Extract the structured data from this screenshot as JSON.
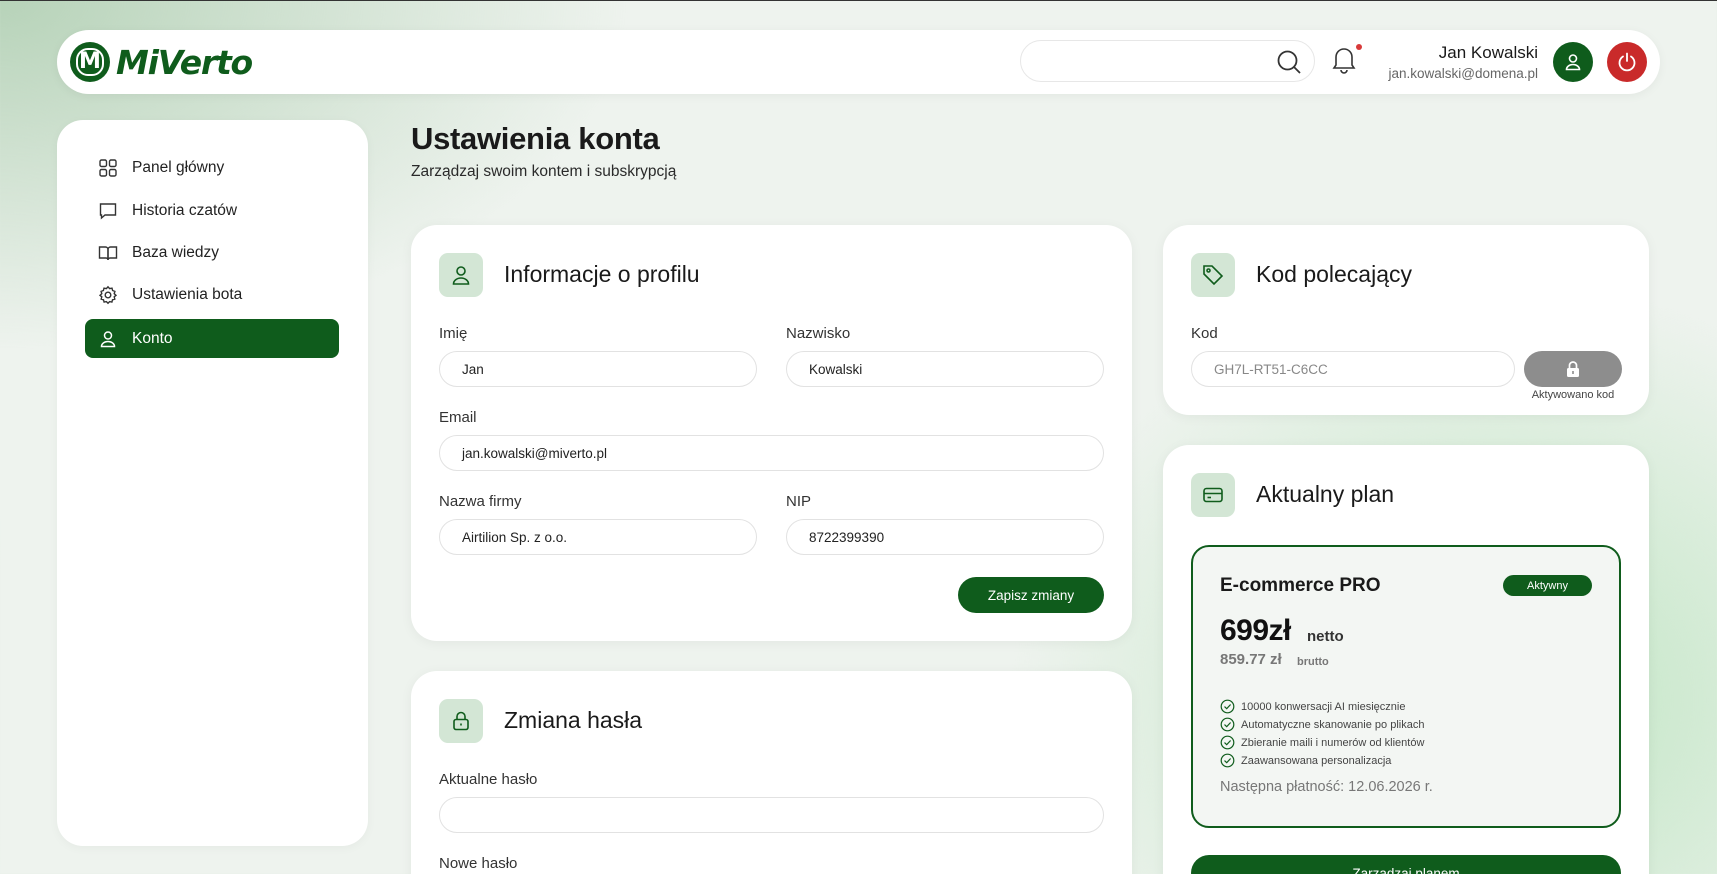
{
  "app": {
    "logo_text": "MiVerto",
    "logo_letter": "M"
  },
  "header": {
    "search_placeholder": "",
    "user_name": "Jan Kowalski",
    "user_email": "jan.kowalski@domena.pl"
  },
  "sidebar": {
    "items": [
      {
        "label": "Panel główny",
        "icon": "grid-icon"
      },
      {
        "label": "Historia czatów",
        "icon": "chat-icon"
      },
      {
        "label": "Baza wiedzy",
        "icon": "book-icon"
      },
      {
        "label": "Ustawienia bota",
        "icon": "gear-icon"
      },
      {
        "label": "Konto",
        "icon": "user-icon",
        "active": true
      }
    ]
  },
  "page": {
    "title": "Ustawienia konta",
    "subtitle": "Zarządzaj swoim kontem i subskrypcją"
  },
  "profile": {
    "title": "Informacje o profilu",
    "first_name_label": "Imię",
    "first_name_value": "Jan",
    "last_name_label": "Nazwisko",
    "last_name_value": "Kowalski",
    "email_label": "Email",
    "email_value": "jan.kowalski@miverto.pl",
    "company_label": "Nazwa firmy",
    "company_value": "Airtilion Sp. z o.o.",
    "nip_label": "NIP",
    "nip_value": "8722399390",
    "save_label": "Zapisz zmiany"
  },
  "password": {
    "title": "Zmiana hasła",
    "current_label": "Aktualne hasło",
    "current_value": "",
    "new_label": "Nowe hasło"
  },
  "referral": {
    "title": "Kod polecający",
    "code_label": "Kod",
    "code_value": "GH7L-RT51-C6CC",
    "activated_text": "Aktywowano kod"
  },
  "plan": {
    "title": "Aktualny plan",
    "name": "E-commerce PRO",
    "status": "Aktywny",
    "price": "699zł",
    "price_suffix": "netto",
    "price_brutto": "859.77 zł",
    "brutto_label": "brutto",
    "features": [
      "10000 konwersacji AI miesięcznie",
      "Automatyczne skanowanie po plikach",
      "Zbieranie maili i numerów od klientów",
      "Zaawansowana personalizacja"
    ],
    "next_payment": "Następna płatność: 12.06.2026 r.",
    "manage_label": "Zarządzaj planem"
  },
  "colors": {
    "brand": "#0f5c1c",
    "danger": "#c92a2a",
    "icon_bg": "#d3e6d5"
  }
}
